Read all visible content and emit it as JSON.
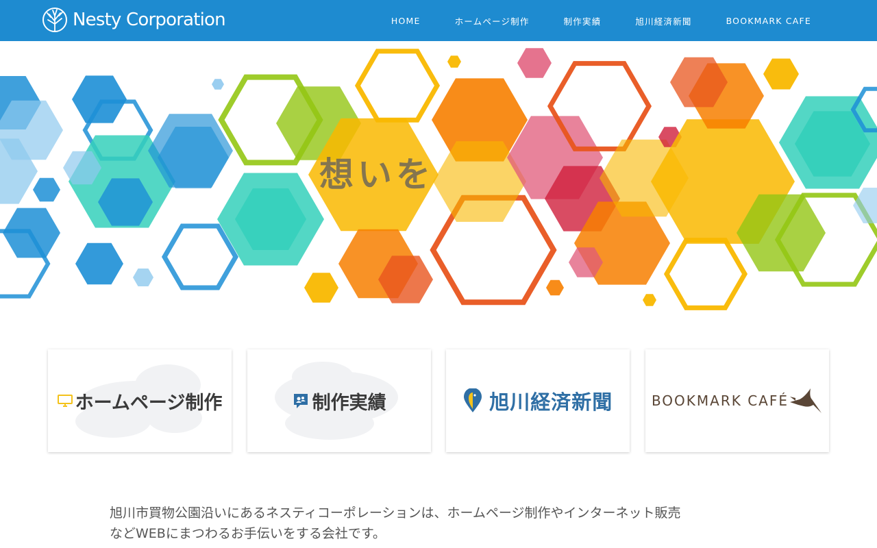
{
  "header": {
    "logo_text": "Nesty Corporation",
    "nav": [
      "HOME",
      "ホームページ制作",
      "制作実績",
      "旭川経済新聞",
      "BOOKMARK CAFE"
    ]
  },
  "hero": {
    "headline": "想いを"
  },
  "cards": [
    {
      "label": "ホームページ制作",
      "icon": "monitor-icon"
    },
    {
      "label": "制作実績",
      "icon": "users-chat-icon"
    },
    {
      "label": "旭川経済新聞",
      "icon": "bird-pin-icon"
    },
    {
      "label": "BOOKMARK CAFÉ",
      "icon": "swallow-icon"
    }
  ],
  "intro": {
    "line1": "旭川市買物公園沿いにあるネスティコーポレーションは、ホームページ制作やインターネット販売",
    "line2": "などWEBにまつわるお手伝いをする会社です。"
  },
  "colors": {
    "header_bg": "#1e8bd0",
    "hex_blue": "#1d8fd6",
    "hex_teal": "#35d0bb",
    "hex_green": "#93c614",
    "hex_yellow": "#f9b800",
    "hex_orange": "#f77f00",
    "hex_red": "#d01f3c"
  }
}
